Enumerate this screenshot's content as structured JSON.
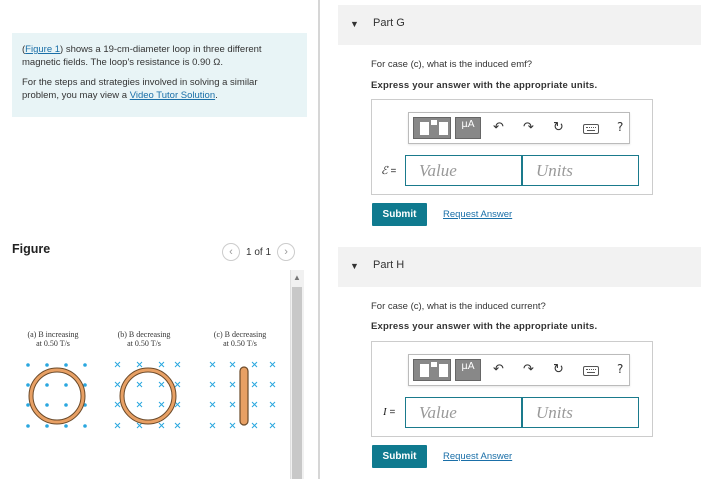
{
  "intro": {
    "figure_link": "Figure 1",
    "text1_pre": "(",
    "text1_post": ") shows a 19-cm-diameter loop in three different magnetic fields. The loop's resistance is 0.90 Ω.",
    "text2": "For the steps and strategies involved in solving a similar problem, you may view a ",
    "tutor_link": "Video Tutor Solution",
    "text2_end": "."
  },
  "figure_panel": {
    "title": "Figure",
    "pager": "1 of 1",
    "labels": {
      "a1": "(a) B increasing",
      "a2": "at 0.50 T/s",
      "b1": "(b) B decreasing",
      "b2": "at 0.50 T/s",
      "c1": "(c) B decreasing",
      "c2": "at 0.50 T/s"
    }
  },
  "parts": [
    {
      "name": "Part G",
      "question": "For case (c), what is the induced emf?",
      "instruction": "Express your answer with the appropriate units.",
      "symbol": "ℰ",
      "eq": " =",
      "value_placeholder": "Value",
      "units_placeholder": "Units",
      "submit": "Submit",
      "request": "Request Answer"
    },
    {
      "name": "Part H",
      "question": "For case (c), what is the induced current?",
      "instruction": "Express your answer with the appropriate units.",
      "symbol": "I",
      "eq": " =",
      "value_placeholder": "Value",
      "units_placeholder": "Units",
      "submit": "Submit",
      "request": "Request Answer"
    }
  ],
  "toolbar": {
    "mu_label": "μA",
    "undo_icon": "↶",
    "redo_icon": "↷",
    "reset_icon": "↻",
    "help_label": "?"
  },
  "colors": {
    "accent": "#0f7a8f",
    "link": "#1a6fa8",
    "dot": "#2aa7df",
    "loop": "#e8a064"
  }
}
